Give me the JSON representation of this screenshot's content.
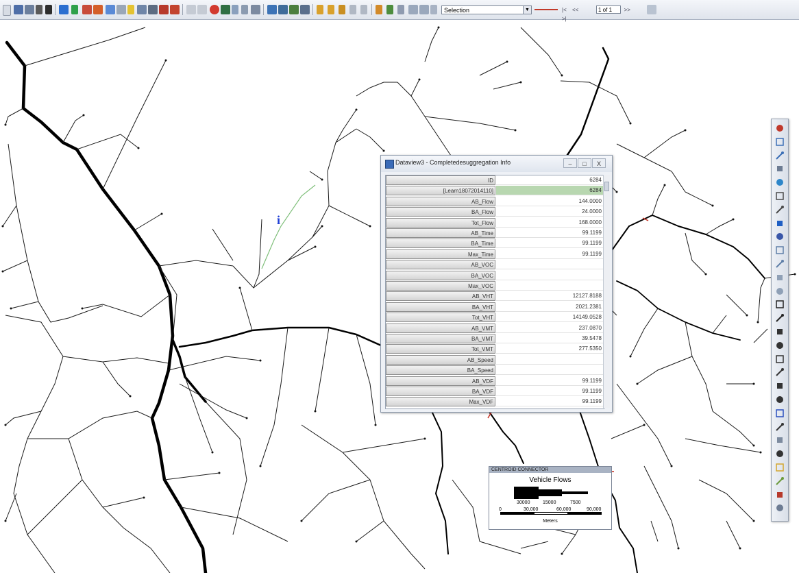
{
  "toolbar": {
    "layer_select_value": "Selection",
    "record_count": "1 of 1",
    "record_nav": [
      "|<",
      "<<",
      ">>",
      ">|"
    ]
  },
  "map": {
    "info_marker": "i"
  },
  "dataview": {
    "title": "Dataview3 - Completedesuggregation Info",
    "minimize": "–",
    "maximize": "□",
    "close": "X",
    "rows": [
      {
        "field": "ID",
        "value": "6284"
      },
      {
        "field": "[Learn18072014110]",
        "value": "6284"
      },
      {
        "field": "AB_Flow",
        "value": "144.0000"
      },
      {
        "field": "BA_Flow",
        "value": "24.0000"
      },
      {
        "field": "Tot_Flow",
        "value": "168.0000"
      },
      {
        "field": "AB_Time",
        "value": "99.1199"
      },
      {
        "field": "BA_Time",
        "value": "99.1199"
      },
      {
        "field": "Max_Time",
        "value": "99.1199"
      },
      {
        "field": "AB_VOC",
        "value": ""
      },
      {
        "field": "BA_VOC",
        "value": ""
      },
      {
        "field": "Max_VOC",
        "value": ""
      },
      {
        "field": "AB_VHT",
        "value": "12127.8188"
      },
      {
        "field": "BA_VHT",
        "value": "2021.2381"
      },
      {
        "field": "Tot_VHT",
        "value": "14149.0528"
      },
      {
        "field": "AB_VMT",
        "value": "237.0870"
      },
      {
        "field": "BA_VMT",
        "value": "39.5478"
      },
      {
        "field": "Tot_VMT",
        "value": "277.5350"
      },
      {
        "field": "AB_Speed",
        "value": ""
      },
      {
        "field": "BA_Speed",
        "value": ""
      },
      {
        "field": "AB_VDF",
        "value": "99.1199"
      },
      {
        "field": "BA_VDF",
        "value": "99.1199"
      },
      {
        "field": "Max_VDF",
        "value": "99.1199"
      }
    ]
  },
  "legend": {
    "header": "CENTROID CONNECTOR",
    "title": "Vehicle Flows",
    "flow_labels": [
      "30000",
      "15000",
      "7500"
    ],
    "distance_labels": [
      "0",
      "30,000",
      "60,000",
      "90,000"
    ],
    "units": "Meters"
  },
  "colors": {
    "accent_selected_cell": "#b8d7b0",
    "road_color": "#000000",
    "selected_link": "#7fbf7a",
    "info_marker": "#1f3fd6"
  },
  "icons": {
    "tools": [
      "measure-icon",
      "zoom-in-icon",
      "zoom-out-icon",
      "pan-icon",
      "globe-icon",
      "ruler-icon",
      "scale-icon",
      "info-icon",
      "brush-icon",
      "layer-icon",
      "layer-icon-2",
      "select-icon",
      "pointer-icon",
      "text-icon",
      "text-italic-icon",
      "rectangle-icon",
      "circle-icon",
      "ellipse-icon",
      "polygon-icon",
      "freehand-icon",
      "line-icon",
      "node-icon",
      "person-icon",
      "grid-icon",
      "table-icon",
      "map-icon",
      "chart-icon",
      "route-icon",
      "help-icon"
    ]
  }
}
